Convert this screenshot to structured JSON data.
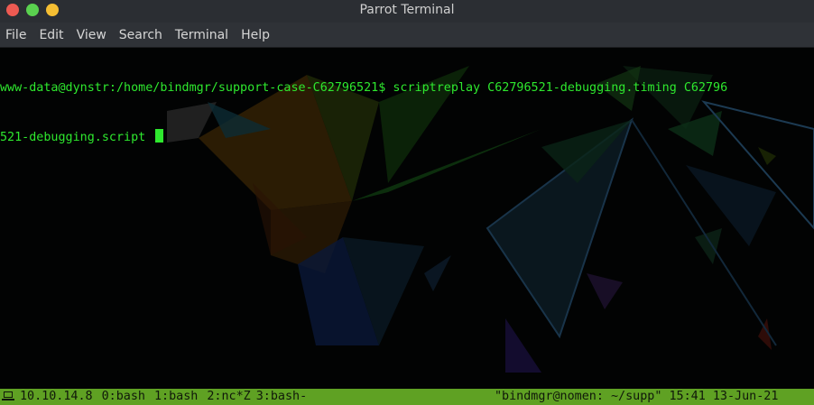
{
  "window": {
    "title": "Parrot Terminal"
  },
  "menu": {
    "items": [
      "File",
      "Edit",
      "View",
      "Search",
      "Terminal",
      "Help"
    ]
  },
  "terminal": {
    "lines": [
      "www-data@dynstr:/home/bindmgr/support-case-C62796521$ scriptreplay C62796521-debugging.timing C62796",
      "521-debugging.script "
    ],
    "text_color": "#2ee82e"
  },
  "statusbar": {
    "host": "10.10.14.8",
    "windows": [
      "0:bash",
      "1:bash",
      "2:nc*Z",
      "3:bash-"
    ],
    "right_text": "\"bindmgr@nomen: ~/supp\" 15:41 13-Jun-21",
    "bg_color": "#5fa123"
  }
}
